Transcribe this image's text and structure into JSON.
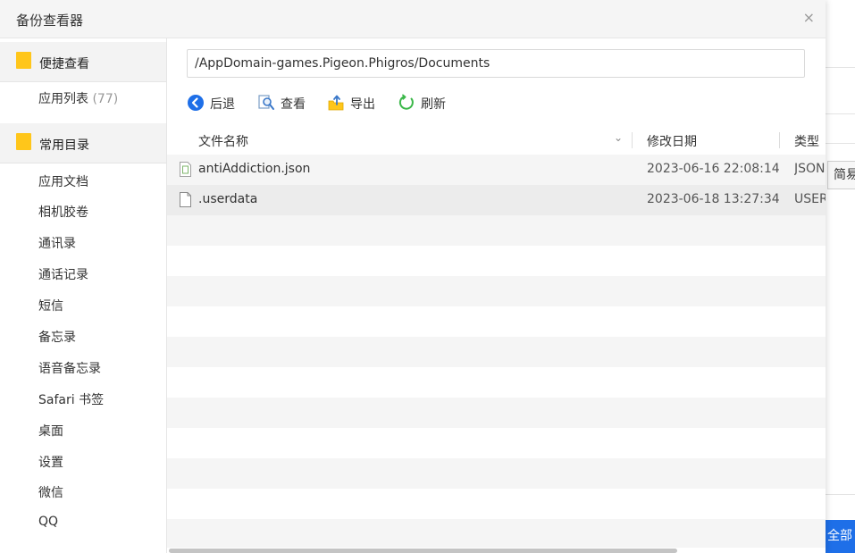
{
  "dialog": {
    "title": "备份查看器",
    "close_label": "×"
  },
  "sidebar": {
    "quick_view": {
      "label": "便捷查看",
      "apps_label": "应用列表",
      "apps_count": "(77)"
    },
    "common_dirs": {
      "label": "常用目录",
      "items": [
        "应用文档",
        "相机胶卷",
        "通讯录",
        "通话记录",
        "短信",
        "备忘录",
        "语音备忘录",
        "Safari 书签",
        "桌面",
        "设置",
        "微信",
        "QQ"
      ]
    }
  },
  "path": {
    "value": "/AppDomain-games.Pigeon.Phigros/Documents"
  },
  "toolbar": {
    "back": "后退",
    "view": "查看",
    "export": "导出",
    "refresh": "刷新"
  },
  "table": {
    "columns": {
      "name": "文件名称",
      "modified": "修改日期",
      "type": "类型"
    },
    "rows": [
      {
        "name": "antiAddiction.json",
        "modified": "2023-06-16 22:08:14",
        "type": "JSON",
        "icon": "json-file-icon"
      },
      {
        "name": ".userdata",
        "modified": "2023-06-18 13:27:34",
        "type": "USER",
        "icon": "file-icon"
      }
    ]
  },
  "background_app": {
    "simple_label": "简易",
    "all_button_label": "全部"
  },
  "colors": {
    "folder": "#ffc61a",
    "accent_blue": "#1e6fe8",
    "refresh_green": "#3cb84a"
  }
}
